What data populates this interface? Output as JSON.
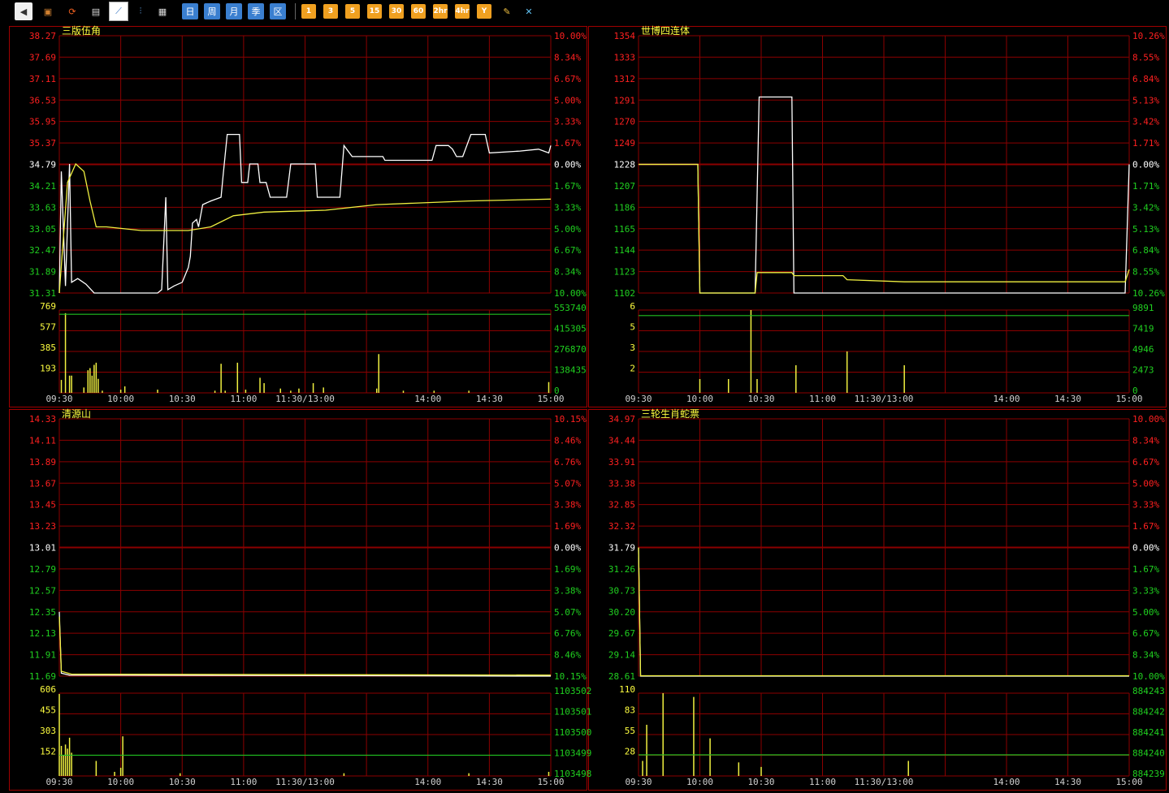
{
  "toolbar": {
    "icons": [
      "back-icon",
      "box-icon",
      "refresh-icon",
      "clipboard-icon",
      "line-chart-icon",
      "kline-icon",
      "table-icon"
    ],
    "period_buttons": [
      "日",
      "周",
      "月",
      "季",
      "区"
    ],
    "minute_buttons": [
      "1",
      "3",
      "5",
      "15",
      "30",
      "60",
      "2hr",
      "4hr",
      "Y"
    ],
    "tool_icons": [
      "edit-icon",
      "tools-icon"
    ]
  },
  "colors": {
    "background": "#000000",
    "grid": "#8b0000",
    "up": "#ff2020",
    "down": "#20d020",
    "price_line": "#ffffff",
    "avg_line": "#f0f040",
    "volume": "#f0f040",
    "vol_avg": "#20c020"
  },
  "time_labels": [
    "09:30",
    "10:00",
    "10:30",
    "11:00",
    "11:30/13:00",
    "14:00",
    "14:30",
    "15:00"
  ],
  "chart_data": [
    {
      "type": "line",
      "title": "三版伍角",
      "price_ticks": [
        "38.27",
        "37.69",
        "37.11",
        "36.53",
        "35.95",
        "35.37",
        "34.79",
        "34.21",
        "33.63",
        "33.05",
        "32.47",
        "31.89",
        "31.31"
      ],
      "pct_ticks": [
        "10.00%",
        "8.34%",
        "6.67%",
        "5.00%",
        "3.33%",
        "1.67%",
        "0.00%",
        "1.67%",
        "3.33%",
        "5.00%",
        "6.67%",
        "8.34%",
        "10.00%"
      ],
      "ylim": [
        31.31,
        38.27
      ],
      "prev_close": 34.79,
      "series": [
        {
          "values": [
            [
              0,
              31.31
            ],
            [
              1,
              34.6
            ],
            [
              3,
              31.5
            ],
            [
              5,
              34.8
            ],
            [
              6,
              31.6
            ],
            [
              9,
              31.7
            ],
            [
              13,
              31.55
            ],
            [
              17,
              31.31
            ],
            [
              48,
              31.31
            ],
            [
              50,
              31.4
            ],
            [
              52,
              33.9
            ],
            [
              53,
              31.4
            ],
            [
              56,
              31.5
            ],
            [
              60,
              31.6
            ],
            [
              63,
              32.0
            ],
            [
              64,
              32.3
            ],
            [
              65,
              33.2
            ],
            [
              67,
              33.3
            ],
            [
              68,
              33.1
            ],
            [
              70,
              33.7
            ],
            [
              74,
              33.8
            ],
            [
              79,
              33.9
            ],
            [
              80,
              34.5
            ],
            [
              82,
              35.6
            ],
            [
              88,
              35.6
            ],
            [
              89,
              34.3
            ],
            [
              92,
              34.3
            ],
            [
              93,
              34.8
            ],
            [
              97,
              34.8
            ],
            [
              98,
              34.3
            ],
            [
              101,
              34.3
            ],
            [
              103,
              33.9
            ],
            [
              111,
              33.9
            ],
            [
              113,
              34.8
            ],
            [
              125,
              34.8
            ],
            [
              126,
              33.9
            ],
            [
              137,
              33.9
            ],
            [
              139,
              35.3
            ],
            [
              143,
              35.0
            ],
            [
              158,
              35.0
            ],
            [
              159,
              34.9
            ],
            [
              182,
              34.9
            ],
            [
              184,
              35.3
            ],
            [
              190,
              35.3
            ],
            [
              192,
              35.2
            ],
            [
              194,
              35.0
            ],
            [
              197,
              35.0
            ],
            [
              201,
              35.6
            ],
            [
              208,
              35.6
            ],
            [
              210,
              35.1
            ],
            [
              225,
              35.15
            ],
            [
              234,
              35.2
            ],
            [
              239,
              35.1
            ],
            [
              240,
              35.3
            ]
          ]
        },
        {
          "values": [
            [
              0,
              31.31
            ],
            [
              4,
              34.3
            ],
            [
              8,
              34.8
            ],
            [
              12,
              34.6
            ],
            [
              15,
              33.8
            ],
            [
              18,
              33.1
            ],
            [
              23,
              33.1
            ],
            [
              40,
              33.0
            ],
            [
              63,
              33.0
            ],
            [
              74,
              33.1
            ],
            [
              85,
              33.4
            ],
            [
              100,
              33.5
            ],
            [
              130,
              33.55
            ],
            [
              155,
              33.7
            ],
            [
              200,
              33.8
            ],
            [
              240,
              33.85
            ]
          ]
        }
      ],
      "volume_ticks": [
        "769",
        "577",
        "385",
        "193"
      ],
      "volume_right_ticks": [
        "553740",
        "415305",
        "276870",
        "138435",
        "0"
      ],
      "volume_max": 769,
      "volume_avg": 730,
      "volumes": [
        [
          1,
          120
        ],
        [
          3,
          740
        ],
        [
          5,
          160
        ],
        [
          6,
          160
        ],
        [
          12,
          50
        ],
        [
          14,
          210
        ],
        [
          15,
          230
        ],
        [
          16,
          160
        ],
        [
          17,
          260
        ],
        [
          18,
          280
        ],
        [
          19,
          130
        ],
        [
          21,
          20
        ],
        [
          30,
          30
        ],
        [
          32,
          60
        ],
        [
          48,
          30
        ],
        [
          76,
          20
        ],
        [
          79,
          270
        ],
        [
          81,
          20
        ],
        [
          87,
          280
        ],
        [
          91,
          30
        ],
        [
          98,
          140
        ],
        [
          100,
          90
        ],
        [
          108,
          40
        ],
        [
          113,
          20
        ],
        [
          117,
          40
        ],
        [
          124,
          90
        ],
        [
          129,
          50
        ],
        [
          155,
          40
        ],
        [
          156,
          360
        ],
        [
          168,
          20
        ],
        [
          183,
          20
        ],
        [
          200,
          20
        ],
        [
          239,
          100
        ]
      ]
    },
    {
      "type": "line",
      "title": "世博四连体",
      "price_ticks": [
        "1354",
        "1333",
        "1312",
        "1291",
        "1270",
        "1249",
        "1228",
        "1207",
        "1186",
        "1165",
        "1144",
        "1123",
        "1102"
      ],
      "pct_ticks": [
        "10.26%",
        "8.55%",
        "6.84%",
        "5.13%",
        "3.42%",
        "1.71%",
        "0.00%",
        "1.71%",
        "3.42%",
        "5.13%",
        "6.84%",
        "8.55%",
        "10.26%"
      ],
      "ylim": [
        1102,
        1354
      ],
      "prev_close": 1228,
      "series": [
        {
          "values": [
            [
              0,
              1228
            ],
            [
              29,
              1228
            ],
            [
              30,
              1102
            ],
            [
              57,
              1102
            ],
            [
              59,
              1294
            ],
            [
              75,
              1294
            ],
            [
              76,
              1102
            ],
            [
              238,
              1102
            ],
            [
              240,
              1228
            ]
          ]
        },
        {
          "values": [
            [
              0,
              1228
            ],
            [
              29,
              1228
            ],
            [
              30,
              1102
            ],
            [
              57,
              1102
            ],
            [
              58,
              1122
            ],
            [
              75,
              1122
            ],
            [
              76,
              1119
            ],
            [
              100,
              1119
            ],
            [
              102,
              1115
            ],
            [
              130,
              1113
            ],
            [
              238,
              1113
            ],
            [
              240,
              1125
            ]
          ]
        }
      ],
      "volume_ticks": [
        "6",
        "5",
        "3",
        "2"
      ],
      "volume_right_ticks": [
        "9891",
        "7419",
        "4946",
        "2473",
        "0"
      ],
      "volume_max": 6,
      "volume_avg": 5.6,
      "volumes": [
        [
          30,
          1
        ],
        [
          44,
          1
        ],
        [
          55,
          6
        ],
        [
          58,
          1
        ],
        [
          77,
          2
        ],
        [
          102,
          3
        ],
        [
          130,
          2
        ]
      ]
    },
    {
      "type": "line",
      "title": "清源山",
      "price_ticks": [
        "14.33",
        "14.11",
        "13.89",
        "13.67",
        "13.45",
        "13.23",
        "13.01",
        "12.79",
        "12.57",
        "12.35",
        "12.13",
        "11.91",
        "11.69"
      ],
      "pct_ticks": [
        "10.15%",
        "8.46%",
        "6.76%",
        "5.07%",
        "3.38%",
        "1.69%",
        "0.00%",
        "1.69%",
        "3.38%",
        "5.07%",
        "6.76%",
        "8.46%",
        "10.15%"
      ],
      "ylim": [
        11.69,
        14.33
      ],
      "prev_close": 13.01,
      "series": [
        {
          "values": [
            [
              0,
              12.35
            ],
            [
              1,
              11.72
            ],
            [
              5,
              11.7
            ],
            [
              240,
              11.69
            ]
          ]
        },
        {
          "values": [
            [
              0,
              12.3
            ],
            [
              1,
              11.74
            ],
            [
              6,
              11.71
            ],
            [
              240,
              11.7
            ]
          ]
        }
      ],
      "volume_ticks": [
        "606",
        "455",
        "303",
        "152"
      ],
      "volume_right_ticks": [
        "1103502",
        "1103501",
        "1103500",
        "1103499",
        "1103498"
      ],
      "volume_max": 606,
      "volume_avg": 152,
      "volumes": [
        [
          0,
          600
        ],
        [
          1,
          220
        ],
        [
          2,
          150
        ],
        [
          3,
          230
        ],
        [
          4,
          200
        ],
        [
          5,
          280
        ],
        [
          6,
          170
        ],
        [
          18,
          110
        ],
        [
          27,
          30
        ],
        [
          30,
          60
        ],
        [
          31,
          290
        ],
        [
          59,
          20
        ],
        [
          139,
          20
        ],
        [
          200,
          20
        ],
        [
          239,
          30
        ]
      ]
    },
    {
      "type": "line",
      "title": "三轮生肖蛇票",
      "price_ticks": [
        "34.97",
        "34.44",
        "33.91",
        "33.38",
        "32.85",
        "32.32",
        "31.79",
        "31.26",
        "30.73",
        "30.20",
        "29.67",
        "29.14",
        "28.61"
      ],
      "pct_ticks": [
        "10.00%",
        "8.34%",
        "6.67%",
        "5.00%",
        "3.33%",
        "1.67%",
        "0.00%",
        "1.67%",
        "3.33%",
        "5.00%",
        "6.67%",
        "8.34%",
        "10.00%"
      ],
      "ylim": [
        28.61,
        34.97
      ],
      "prev_close": 31.79,
      "series": [
        {
          "values": [
            [
              0,
              31.79
            ],
            [
              1,
              28.61
            ],
            [
              240,
              28.61
            ]
          ]
        },
        {
          "values": [
            [
              0,
              31.79
            ],
            [
              1,
              28.62
            ],
            [
              240,
              28.62
            ]
          ]
        }
      ],
      "volume_ticks": [
        "110",
        "83",
        "55",
        "28"
      ],
      "volume_right_ticks": [
        "884243",
        "884242",
        "884241",
        "884240",
        "884239"
      ],
      "volume_max": 110,
      "volume_avg": 28,
      "volumes": [
        [
          2,
          20
        ],
        [
          4,
          68
        ],
        [
          12,
          110
        ],
        [
          27,
          105
        ],
        [
          35,
          50
        ],
        [
          49,
          18
        ],
        [
          60,
          12
        ],
        [
          132,
          20
        ]
      ]
    }
  ]
}
